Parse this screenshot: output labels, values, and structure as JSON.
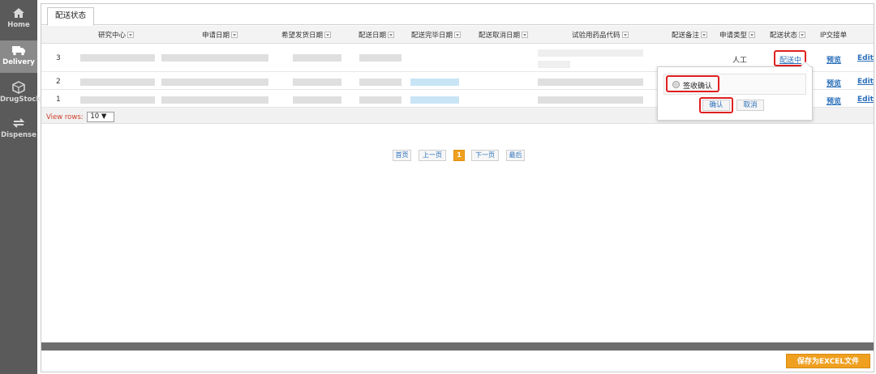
{
  "sidebar": {
    "items": [
      {
        "label": "Home",
        "icon": "home-icon"
      },
      {
        "label": "Delivery",
        "icon": "truck-icon",
        "active": true
      },
      {
        "label": "DrugStock",
        "icon": "box-icon"
      },
      {
        "label": "Dispense",
        "icon": "swap-icon"
      }
    ]
  },
  "tab": {
    "label": "配送状态"
  },
  "table": {
    "headers": {
      "center": "研究中心",
      "apply_date": "申请日期",
      "hope_date": "希望发货日期",
      "ship_date": "配送日期",
      "done_date": "配送完毕日期",
      "cancel_date": "配送取消日期",
      "drug_code": "试验用药品代码",
      "remark": "配送备注",
      "apply_type": "申请类型",
      "status": "配送状态",
      "ip": "IP交接单"
    },
    "rows": [
      {
        "no": "3",
        "apply_type": "人工",
        "status": "配送中",
        "preview": "预览",
        "edit": "Edit"
      },
      {
        "no": "2",
        "preview": "预览",
        "edit": "Edit"
      },
      {
        "no": "1",
        "preview": "预览",
        "edit": "Edit"
      }
    ]
  },
  "view_rows": {
    "label": "View rows:",
    "value": "10"
  },
  "pagination": {
    "first": "首页",
    "prev": "上一页",
    "current": "1",
    "next": "下一页",
    "last": "最后"
  },
  "popup": {
    "option": "签收确认",
    "confirm": "确认",
    "cancel": "取消"
  },
  "footer": {
    "excel_button": "保存为EXCEL文件"
  },
  "colors": {
    "accent": "#f0a020",
    "highlight": "#e02020",
    "link": "#2a6fba",
    "sidebar": "#5a5a5a"
  }
}
